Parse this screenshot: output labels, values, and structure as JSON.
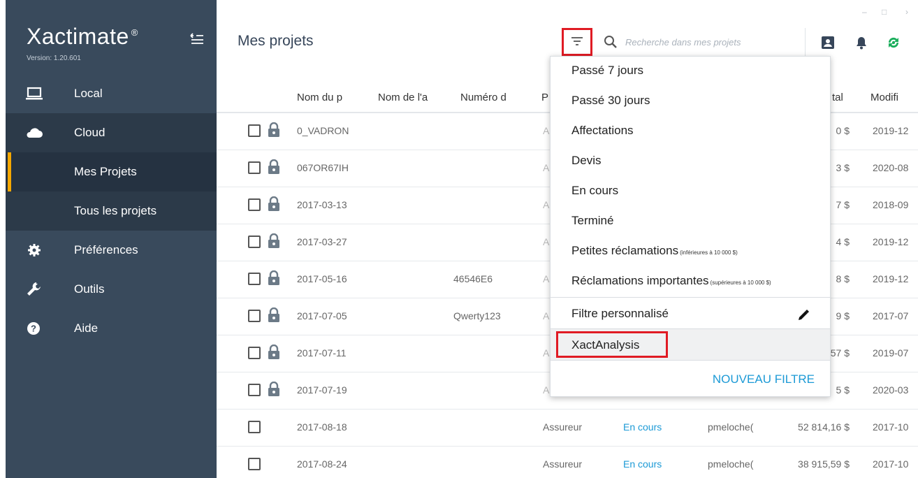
{
  "sidebar": {
    "brand": "Xactimate",
    "brand_mark": "®",
    "version": "Version: 1.20.601",
    "items": [
      {
        "label": "Local",
        "icon": "laptop-icon"
      },
      {
        "label": "Cloud",
        "icon": "cloud-icon"
      },
      {
        "label": "Mes Projets"
      },
      {
        "label": "Tous les projets"
      },
      {
        "label": "Préférences",
        "icon": "gear-icon"
      },
      {
        "label": "Outils",
        "icon": "wrench-icon"
      },
      {
        "label": "Aide",
        "icon": "help-icon"
      }
    ],
    "accent_color": "#f5a800"
  },
  "header": {
    "title": "Mes projets",
    "search_placeholder": "Recherche dans mes projets",
    "window_controls": [
      "–",
      "□",
      "›"
    ]
  },
  "table": {
    "columns": [
      "Nom du p",
      "Nom de l'a",
      "Numéro d",
      "P",
      "tal",
      "Modifi"
    ],
    "rows": [
      {
        "name": "0_VADRON",
        "number": "",
        "type": "A",
        "total": "0 $",
        "modified": "2019-12",
        "locked": true
      },
      {
        "name": "067OR67IH",
        "number": "",
        "type": "A",
        "total": "3 $",
        "modified": "2020-08",
        "locked": true
      },
      {
        "name": "2017-03-13",
        "number": "",
        "type": "A",
        "total": "7 $",
        "modified": "2018-09",
        "locked": true
      },
      {
        "name": "2017-03-27",
        "number": "",
        "type": "A",
        "total": "4 $",
        "modified": "2019-12",
        "locked": true
      },
      {
        "name": "2017-05-16",
        "number": "46546E6",
        "type": "A",
        "total": "8 $",
        "modified": "2019-12",
        "locked": true
      },
      {
        "name": "2017-07-05",
        "number": "Qwerty123",
        "type": "A",
        "total": "9 $",
        "modified": "2017-07",
        "locked": true
      },
      {
        "name": "2017-07-11",
        "number": "",
        "type": "A",
        "total": "57 $",
        "modified": "2019-07",
        "locked": true
      },
      {
        "name": "2017-07-19",
        "number": "",
        "type": "A",
        "total": "5 $",
        "modified": "2020-03",
        "locked": true
      },
      {
        "name": "2017-08-18",
        "number": "",
        "type": "Assureur",
        "status": "En cours",
        "user": "pmeloche(",
        "total": "52 814,16 $",
        "modified": "2017-10",
        "locked": false
      },
      {
        "name": "2017-08-24",
        "number": "",
        "type": "Assureur",
        "status": "En cours",
        "user": "pmeloche(",
        "total": "38 915,59 $",
        "modified": "2017-10",
        "locked": false
      }
    ]
  },
  "dropdown": {
    "items": [
      {
        "label": "Passé 7 jours"
      },
      {
        "label": "Passé 30 jours"
      },
      {
        "label": "Affectations"
      },
      {
        "label": "Devis"
      },
      {
        "label": "En cours"
      },
      {
        "label": "Terminé"
      },
      {
        "label": "Petites réclamations",
        "note": "(inférieures à 10 000 $)"
      },
      {
        "label": "Réclamations importantes",
        "note": "(supérieures à 10 000 $)"
      },
      {
        "label": "Filtre personnalisé"
      },
      {
        "label": "XactAnalysis"
      }
    ],
    "new_filter": "NOUVEAU FILTRE",
    "link_color": "#1c9ad6",
    "highlight_color": "#e01b24"
  }
}
